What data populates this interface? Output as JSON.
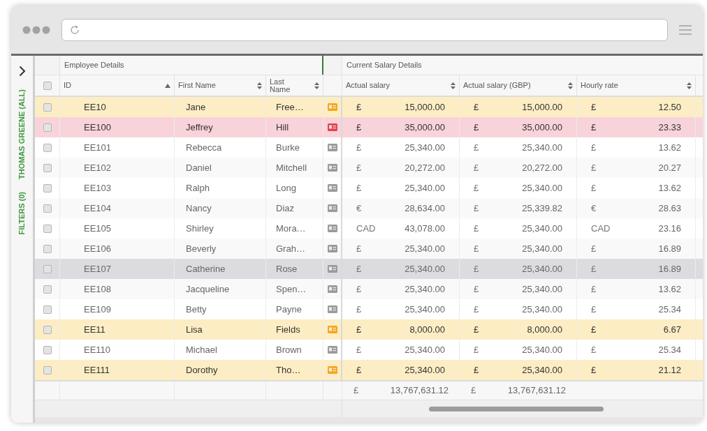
{
  "sidebar": {
    "items": [
      {
        "label": "THOMAS GREENE (ALL)"
      },
      {
        "label": "FILTERS (0)"
      }
    ]
  },
  "table": {
    "groups": [
      {
        "label": "Employee Details"
      },
      {
        "label": "Current Salary Details"
      }
    ],
    "all_checked": false,
    "columns": [
      {
        "label": "ID",
        "sorted": true
      },
      {
        "label": "First Name",
        "sorted": false
      },
      {
        "label": "Last Name",
        "sorted": false
      },
      {
        "label": "Actual salary",
        "sorted": false
      },
      {
        "label": "Actual salary (GBP)",
        "sorted": false
      },
      {
        "label": "Hourly rate",
        "sorted": false
      }
    ],
    "rows": [
      {
        "id": "EE10",
        "first_name": "Jane",
        "last_name": "Free…",
        "kind": "warning",
        "selected": false,
        "checked": false,
        "salary_currency": "£",
        "salary": "15,000.00",
        "gbp_currency": "£",
        "gbp": "15,000.00",
        "rate_currency": "£",
        "rate": "12.50"
      },
      {
        "id": "EE100",
        "first_name": "Jeffrey",
        "last_name": "Hill",
        "kind": "error",
        "selected": false,
        "checked": false,
        "salary_currency": "£",
        "salary": "35,000.00",
        "gbp_currency": "£",
        "gbp": "35,000.00",
        "rate_currency": "£",
        "rate": "23.33"
      },
      {
        "id": "EE101",
        "first_name": "Rebecca",
        "last_name": "Burke",
        "kind": "normal",
        "selected": false,
        "checked": false,
        "salary_currency": "£",
        "salary": "25,340.00",
        "gbp_currency": "£",
        "gbp": "25,340.00",
        "rate_currency": "£",
        "rate": "13.62"
      },
      {
        "id": "EE102",
        "first_name": "Daniel",
        "last_name": "Mitchell",
        "kind": "normal",
        "selected": false,
        "checked": false,
        "salary_currency": "£",
        "salary": "20,272.00",
        "gbp_currency": "£",
        "gbp": "20,272.00",
        "rate_currency": "£",
        "rate": "20.27"
      },
      {
        "id": "EE103",
        "first_name": "Ralph",
        "last_name": "Long",
        "kind": "normal",
        "selected": false,
        "checked": false,
        "salary_currency": "£",
        "salary": "25,340.00",
        "gbp_currency": "£",
        "gbp": "25,340.00",
        "rate_currency": "£",
        "rate": "13.62"
      },
      {
        "id": "EE104",
        "first_name": "Nancy",
        "last_name": "Diaz",
        "kind": "normal",
        "selected": false,
        "checked": false,
        "salary_currency": "€",
        "salary": "28,634.00",
        "gbp_currency": "£",
        "gbp": "25,339.82",
        "rate_currency": "€",
        "rate": "28.63"
      },
      {
        "id": "EE105",
        "first_name": "Shirley",
        "last_name": "Mora…",
        "kind": "normal",
        "selected": false,
        "checked": false,
        "salary_currency": "CAD",
        "salary": "43,078.00",
        "gbp_currency": "£",
        "gbp": "25,340.00",
        "rate_currency": "CAD",
        "rate": "23.16"
      },
      {
        "id": "EE106",
        "first_name": "Beverly",
        "last_name": "Grah…",
        "kind": "normal",
        "selected": false,
        "checked": false,
        "salary_currency": "£",
        "salary": "25,340.00",
        "gbp_currency": "£",
        "gbp": "25,340.00",
        "rate_currency": "£",
        "rate": "16.89"
      },
      {
        "id": "EE107",
        "first_name": "Catherine",
        "last_name": "Rose",
        "kind": "normal",
        "selected": true,
        "checked": false,
        "salary_currency": "£",
        "salary": "25,340.00",
        "gbp_currency": "£",
        "gbp": "25,340.00",
        "rate_currency": "£",
        "rate": "16.89"
      },
      {
        "id": "EE108",
        "first_name": "Jacqueline",
        "last_name": "Spen…",
        "kind": "normal",
        "selected": false,
        "checked": false,
        "salary_currency": "£",
        "salary": "25,340.00",
        "gbp_currency": "£",
        "gbp": "25,340.00",
        "rate_currency": "£",
        "rate": "13.62"
      },
      {
        "id": "EE109",
        "first_name": "Betty",
        "last_name": "Payne",
        "kind": "normal",
        "selected": false,
        "checked": false,
        "salary_currency": "£",
        "salary": "25,340.00",
        "gbp_currency": "£",
        "gbp": "25,340.00",
        "rate_currency": "£",
        "rate": "25.34"
      },
      {
        "id": "EE11",
        "first_name": "Lisa",
        "last_name": "Fields",
        "kind": "warning",
        "selected": false,
        "checked": false,
        "salary_currency": "£",
        "salary": "8,000.00",
        "gbp_currency": "£",
        "gbp": "8,000.00",
        "rate_currency": "£",
        "rate": "6.67"
      },
      {
        "id": "EE110",
        "first_name": "Michael",
        "last_name": "Brown",
        "kind": "normal",
        "selected": false,
        "checked": false,
        "salary_currency": "£",
        "salary": "25,340.00",
        "gbp_currency": "£",
        "gbp": "25,340.00",
        "rate_currency": "£",
        "rate": "25.34"
      },
      {
        "id": "EE111",
        "first_name": "Dorothy",
        "last_name": "Tho…",
        "kind": "warning",
        "selected": false,
        "checked": false,
        "salary_currency": "£",
        "salary": "25,340.00",
        "gbp_currency": "£",
        "gbp": "25,340.00",
        "rate_currency": "£",
        "rate": "21.12"
      }
    ],
    "totals": [
      {
        "currency": "£",
        "value": "13,767,631.12"
      },
      {
        "currency": "£",
        "value": "13,767,631.12"
      }
    ]
  }
}
